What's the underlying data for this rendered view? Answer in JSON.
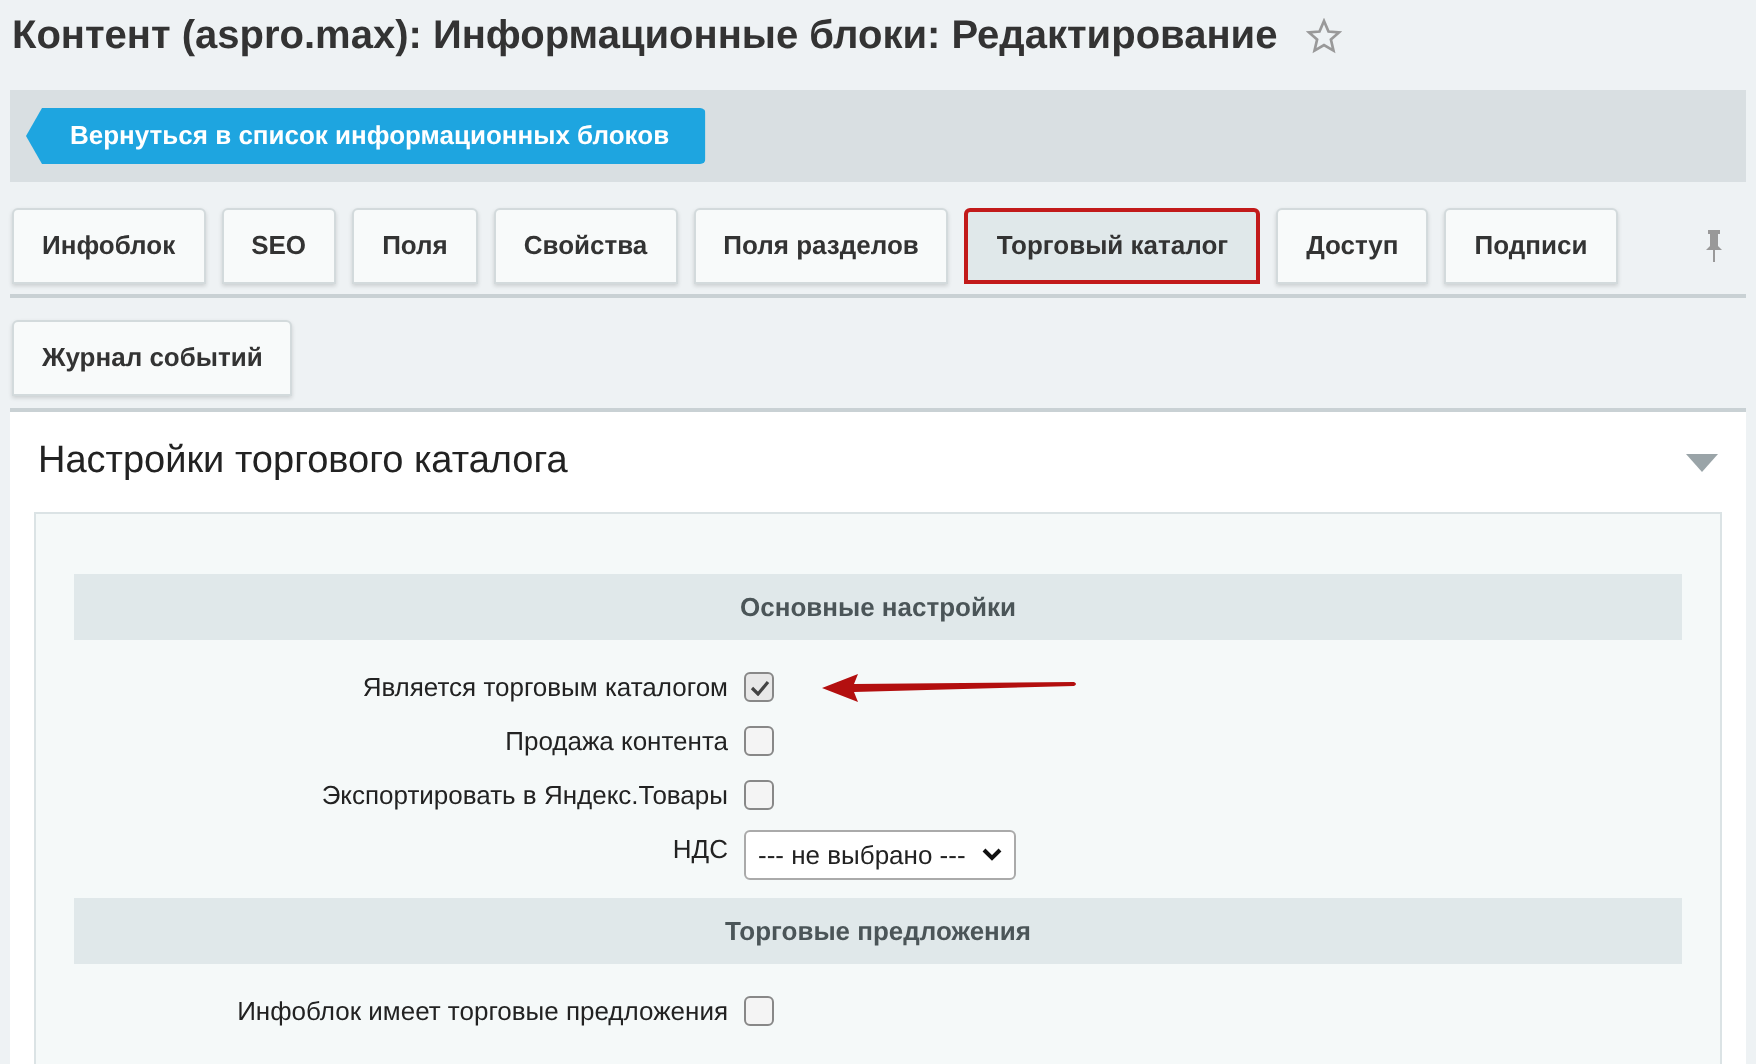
{
  "title": "Контент (aspro.max): Информационные блоки: Редактирование",
  "back_button": "Вернуться в список информационных блоков",
  "tabs": [
    {
      "label": "Инфоблок",
      "selected": false
    },
    {
      "label": "SEO",
      "selected": false
    },
    {
      "label": "Поля",
      "selected": false
    },
    {
      "label": "Свойства",
      "selected": false
    },
    {
      "label": "Поля разделов",
      "selected": false
    },
    {
      "label": "Торговый каталог",
      "selected": true
    },
    {
      "label": "Доступ",
      "selected": false
    },
    {
      "label": "Подписи",
      "selected": false
    }
  ],
  "tabs_row_2": [
    {
      "label": "Журнал событий",
      "selected": false
    }
  ],
  "panel": {
    "title": "Настройки торгового каталога",
    "expanded": true,
    "sections": [
      {
        "title": "Основные настройки",
        "rows": [
          {
            "kind": "checkbox",
            "label": "Является торговым каталогом",
            "checked": true
          },
          {
            "kind": "checkbox",
            "label": "Продажа контента",
            "checked": false
          },
          {
            "kind": "checkbox",
            "label": "Экспортировать в Яндекс.Товары",
            "checked": false
          },
          {
            "kind": "select",
            "label": "НДС",
            "value": "--- не выбрано ---"
          }
        ]
      },
      {
        "title": "Торговые предложения",
        "rows": [
          {
            "kind": "checkbox",
            "label": "Инфоблок имеет торговые предложения",
            "checked": false
          }
        ]
      }
    ]
  }
}
